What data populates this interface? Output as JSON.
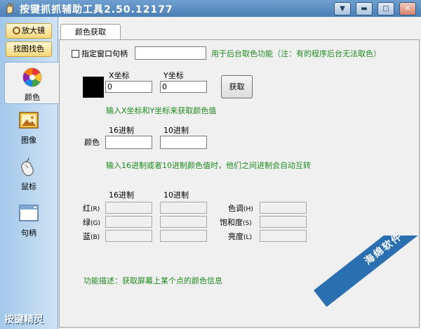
{
  "window": {
    "title": "按键抓抓辅助工具2.50.12177",
    "controls": [
      "chevron-down-icon",
      "minimize-icon",
      "maximize-icon",
      "close-icon"
    ]
  },
  "sidebar": {
    "magnifier_label": "放大镜",
    "find_color_label": "找图找色",
    "items": [
      {
        "label": "颜色",
        "icon": "color-wheel-icon",
        "active": true
      },
      {
        "label": "图像",
        "icon": "image-icon",
        "active": false
      },
      {
        "label": "鼠标",
        "icon": "mouse-icon",
        "active": false
      },
      {
        "label": "句柄",
        "icon": "window-handle-icon",
        "active": false
      }
    ],
    "brand": "按键精灵"
  },
  "tab": {
    "label": "颜色获取"
  },
  "handle": {
    "checkbox_label": "指定窗口句柄",
    "value": "",
    "checked": false,
    "note": "用于后台取色功能（注：有的程序后台无法取色）"
  },
  "coords": {
    "swatch_color": "#000000",
    "x_label": "X坐标",
    "y_label": "Y坐标",
    "x_value": "0",
    "y_value": "0",
    "get_button": "获取",
    "hint": "输入X坐标和Y坐标来获取颜色值"
  },
  "color": {
    "hex_label": "16进制",
    "dec_label": "10进制",
    "row_label": "颜色",
    "hex_value": "",
    "dec_value": "",
    "hint": "输入16进制或者10进制颜色值时，他们之间进制会自动互转"
  },
  "channels": {
    "hex_label": "16进制",
    "dec_label": "10进制",
    "rows": [
      {
        "label": "红",
        "suffix": "(R)",
        "hex": "",
        "dec": ""
      },
      {
        "label": "绿",
        "suffix": "(G)",
        "hex": "",
        "dec": ""
      },
      {
        "label": "蓝",
        "suffix": "(B)",
        "hex": "",
        "dec": ""
      }
    ],
    "hsl": [
      {
        "label": "色调",
        "suffix": "(H)",
        "value": ""
      },
      {
        "label": "饱和度",
        "suffix": "(S)",
        "value": ""
      },
      {
        "label": "亮度",
        "suffix": "(L)",
        "value": ""
      }
    ]
  },
  "description": "功能描述：获取屏幕上某个点的颜色信息",
  "watermark": {
    "text": "海绵软件"
  },
  "colors": {
    "title_bar": "#4a7fb5",
    "hint_text": "#1f8a1f",
    "sidebar": "#b9d7f2"
  }
}
